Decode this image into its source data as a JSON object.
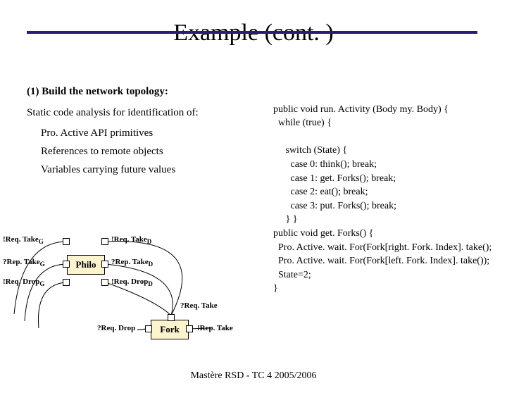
{
  "title": "Example (cont. )",
  "left": {
    "heading": "(1) Build the network topology:",
    "line1": "Static code analysis for identification of:",
    "item1": "Pro. Active API primitives",
    "item2": "References to remote objects",
    "item3": "Variables carrying future values"
  },
  "code": {
    "l1": "public void run. Activity (Body my. Body) {",
    "l2": "  while (true) {",
    "l3": "     switch (State) {",
    "l4": "       case 0: think(); break;",
    "l5": "       case 1: get. Forks(); break;",
    "l6": "       case 2: eat(); break;",
    "l7": "       case 3: put. Forks(); break;",
    "l8": "     } }",
    "l9": "public void get. Forks() {",
    "l10": "  Pro. Active. wait. For(Fork[right. Fork. Index]. take();",
    "l11": "  Pro. Active. wait. For(Fork[left. Fork. Index]. take());",
    "l12": "  State=2;",
    "l13": "}"
  },
  "diagram": {
    "philo": "Philo",
    "fork": "Fork",
    "reqTakeG": "!Req. Take",
    "repTakeG": "?Rep. Take",
    "reqDropG": "!Req. Drop",
    "reqTakeD": "!Req. Take",
    "repTakeD": "?Rep. Take",
    "reqDropD": "!Req. Drop",
    "reqTake": "?Req. Take",
    "reqDrop": "?Req. Drop",
    "repTake": "!Rep. Take",
    "subG": "G",
    "subD": "D"
  },
  "footer": "Mastère RSD - TC 4   2005/2006"
}
